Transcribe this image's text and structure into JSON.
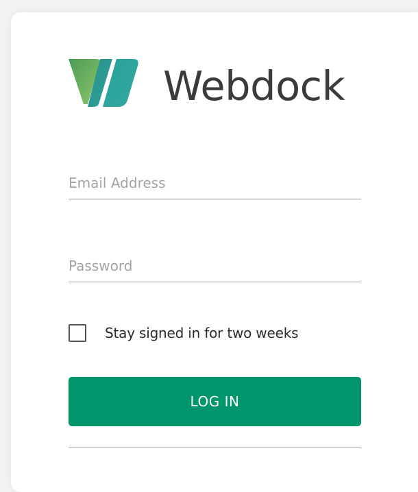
{
  "brand": {
    "name": "Webdock",
    "logo_icon": "webdock-logo-icon",
    "colors": {
      "green_light": "#8cc36c",
      "green_dark": "#3f9a52",
      "teal": "#2aa39a",
      "text": "#3b3b3b"
    }
  },
  "form": {
    "email_placeholder": "Email Address",
    "email_value": "",
    "password_placeholder": "Password",
    "password_value": "",
    "remember_label": "Stay signed in for two weeks",
    "remember_checked": false,
    "submit_label": "LOG IN",
    "submit_color": "#00956a"
  }
}
